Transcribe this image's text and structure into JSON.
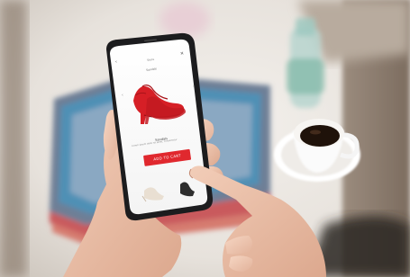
{
  "app": {
    "top_title": "Store",
    "sub_title": "Sandals",
    "product_name": "Sandals",
    "product_desc": "Lorem ipsum dolor sit amet, consectetur",
    "add_button_label": "ADD TO CART",
    "back_icon": "chevron-left-icon",
    "close_icon": "close-icon"
  },
  "colors": {
    "accent": "#e0282e",
    "shoe": "#d61f26",
    "phone_frame": "#1c1c1e"
  }
}
